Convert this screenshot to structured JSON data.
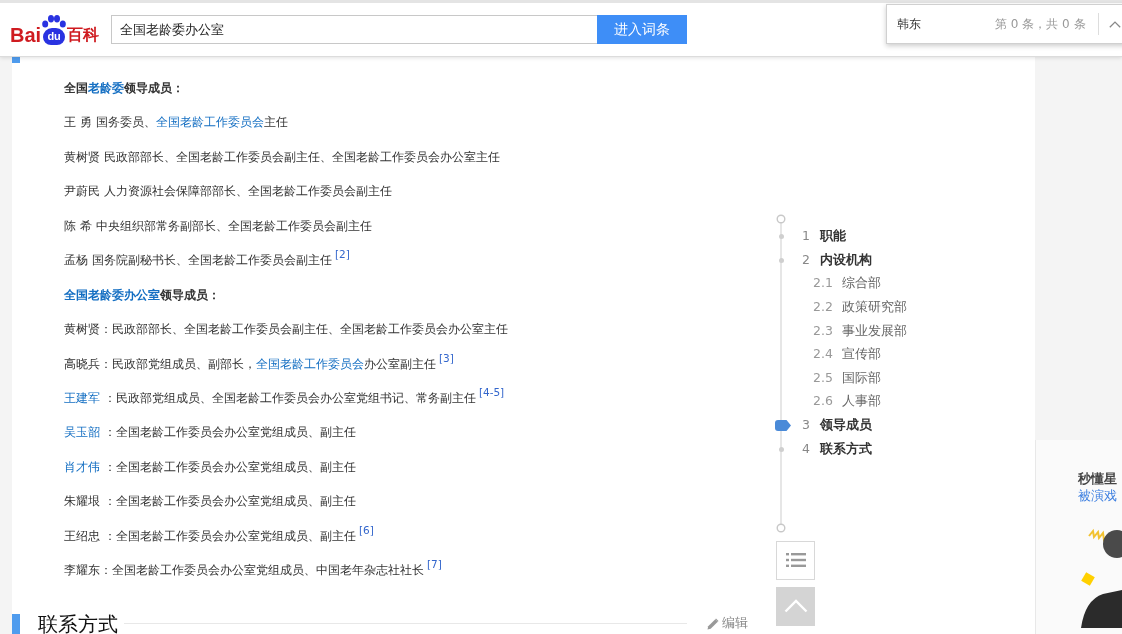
{
  "header": {
    "logo": [
      "Bai",
      "du",
      "百科"
    ],
    "search": {
      "value": "全国老龄委办公室"
    },
    "search_button": "进入词条"
  },
  "find_bar": {
    "value": "韩东",
    "count": "第 0 条，共 0 条"
  },
  "article": {
    "paragraphs": [
      {
        "kind": "heading",
        "segments": [
          {
            "kind": "text",
            "text": "全国"
          },
          {
            "kind": "link",
            "text": "老龄委"
          },
          {
            "kind": "text",
            "text": "领导成员："
          }
        ]
      },
      {
        "kind": "entry",
        "segments": [
          {
            "kind": "text",
            "text": "王 勇 国务委员、"
          },
          {
            "kind": "link",
            "text": "全国老龄工作委员会"
          },
          {
            "kind": "text",
            "text": "主任"
          }
        ]
      },
      {
        "kind": "entry",
        "segments": [
          {
            "kind": "text",
            "text": "黄树贤 民政部部长、全国老龄工作委员会副主任、全国老龄工作委员会办公室主任"
          }
        ]
      },
      {
        "kind": "entry",
        "segments": [
          {
            "kind": "text",
            "text": "尹蔚民 人力资源社会保障部部长、全国老龄工作委员会副主任"
          }
        ]
      },
      {
        "kind": "entry",
        "segments": [
          {
            "kind": "text",
            "text": "陈 希 中央组织部常务副部长、全国老龄工作委员会副主任"
          }
        ]
      },
      {
        "kind": "entry",
        "segments": [
          {
            "kind": "text",
            "text": "孟杨 国务院副秘书长、全国老龄工作委员会副主任"
          }
        ],
        "ref": "[2]"
      },
      {
        "kind": "heading",
        "segments": [
          {
            "kind": "link",
            "text": "全国老龄委办公室"
          },
          {
            "kind": "text",
            "text": "领导成员："
          }
        ]
      },
      {
        "kind": "entry",
        "segments": [
          {
            "kind": "text",
            "text": "黄树贤：民政部部长、全国老龄工作委员会副主任、全国老龄工作委员会办公室主任"
          }
        ]
      },
      {
        "kind": "entry",
        "segments": [
          {
            "kind": "text",
            "text": "高晓兵：民政部党组成员、副部长，"
          },
          {
            "kind": "link",
            "text": "全国老龄工作委员会"
          },
          {
            "kind": "text",
            "text": "办公室副主任"
          }
        ],
        "ref": "[3]"
      },
      {
        "kind": "entry",
        "segments": [
          {
            "kind": "link",
            "text": "王建军"
          },
          {
            "kind": "text",
            "text": " ：民政部党组成员、全国老龄工作委员会办公室党组书记、常务副主任"
          }
        ],
        "ref": "[4-5]"
      },
      {
        "kind": "entry",
        "segments": [
          {
            "kind": "link",
            "text": "吴玉韶"
          },
          {
            "kind": "text",
            "text": " ：全国老龄工作委员会办公室党组成员、副主任"
          }
        ]
      },
      {
        "kind": "entry",
        "segments": [
          {
            "kind": "link",
            "text": "肖才伟"
          },
          {
            "kind": "text",
            "text": " ：全国老龄工作委员会办公室党组成员、副主任"
          }
        ]
      },
      {
        "kind": "entry",
        "segments": [
          {
            "kind": "text",
            "text": "朱耀垠 ：全国老龄工作委员会办公室党组成员、副主任"
          }
        ]
      },
      {
        "kind": "entry",
        "segments": [
          {
            "kind": "text",
            "text": "王绍忠 ：全国老龄工作委员会办公室党组成员、副主任"
          }
        ],
        "ref": "[6]"
      },
      {
        "kind": "entry",
        "segments": [
          {
            "kind": "text",
            "text": "李耀东：全国老龄工作委员会办公室党组成员、中国老年杂志社社长"
          }
        ],
        "ref": "[7]"
      }
    ],
    "next_section": {
      "title": "联系方式",
      "edit": "编辑"
    }
  },
  "toc": {
    "items": [
      {
        "number": "1",
        "title": "职能",
        "selected": false
      },
      {
        "number": "2",
        "title": "内设机构",
        "selected": false,
        "children": [
          {
            "number": "2.1",
            "title": "综合部",
            "selected": false
          },
          {
            "number": "2.2",
            "title": "政策研究部",
            "selected": false
          },
          {
            "number": "2.3",
            "title": "事业发展部",
            "selected": false
          },
          {
            "number": "2.4",
            "title": "宣传部",
            "selected": false
          },
          {
            "number": "2.5",
            "title": "国际部",
            "selected": false
          },
          {
            "number": "2.6",
            "title": "人事部",
            "selected": false
          }
        ]
      },
      {
        "number": "3",
        "title": "领导成员",
        "selected": true
      },
      {
        "number": "4",
        "title": "联系方式",
        "selected": false
      }
    ]
  },
  "ad": {
    "title": "秒懂星",
    "subtitle": "被演戏"
  }
}
